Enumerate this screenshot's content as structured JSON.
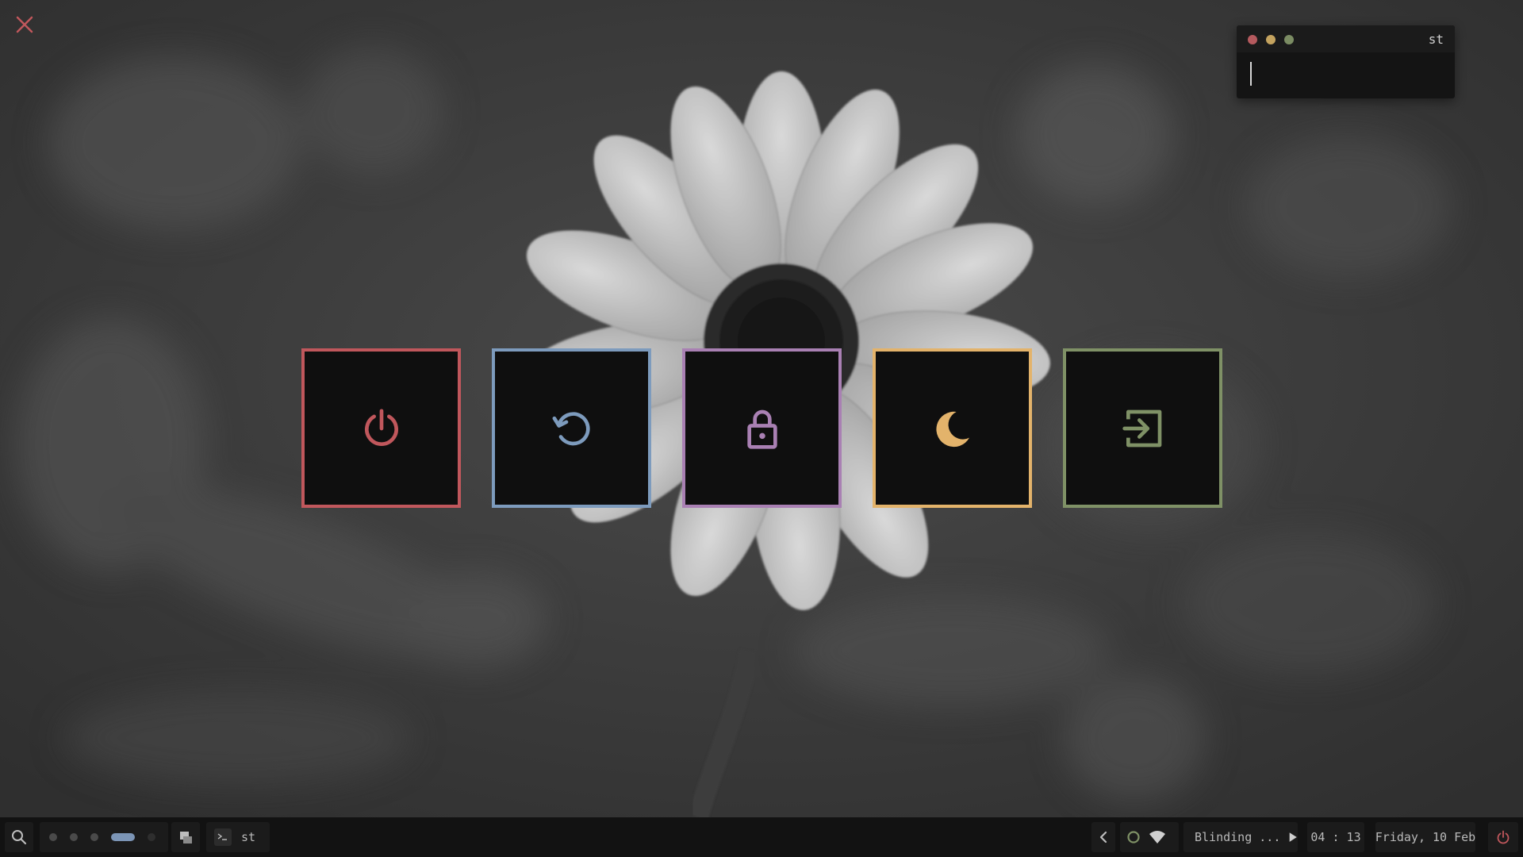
{
  "terminal": {
    "title": "st"
  },
  "power_menu": {
    "buttons": [
      {
        "name": "power-off",
        "icon": "power-icon",
        "color": "#c0575c"
      },
      {
        "name": "reboot",
        "icon": "reboot-icon",
        "color": "#7d9bbd"
      },
      {
        "name": "lock",
        "icon": "lock-icon",
        "color": "#a980b3"
      },
      {
        "name": "suspend",
        "icon": "moon-icon",
        "color": "#e3b36b"
      },
      {
        "name": "logout",
        "icon": "logout-icon",
        "color": "#7f9166"
      }
    ]
  },
  "bar": {
    "workspaces": {
      "count": 5,
      "active_index": 3
    },
    "task": {
      "label": "st"
    },
    "media": {
      "title": "Blinding ..."
    },
    "clock": "04 : 13",
    "date": "Friday, 10 Feb"
  },
  "colors": {
    "accent_red": "#c0575c",
    "accent_blue": "#7d9bbd",
    "accent_purple": "#a980b3",
    "accent_yellow": "#e3b36b",
    "accent_green": "#7f9166",
    "bar_bg": "#121212"
  }
}
